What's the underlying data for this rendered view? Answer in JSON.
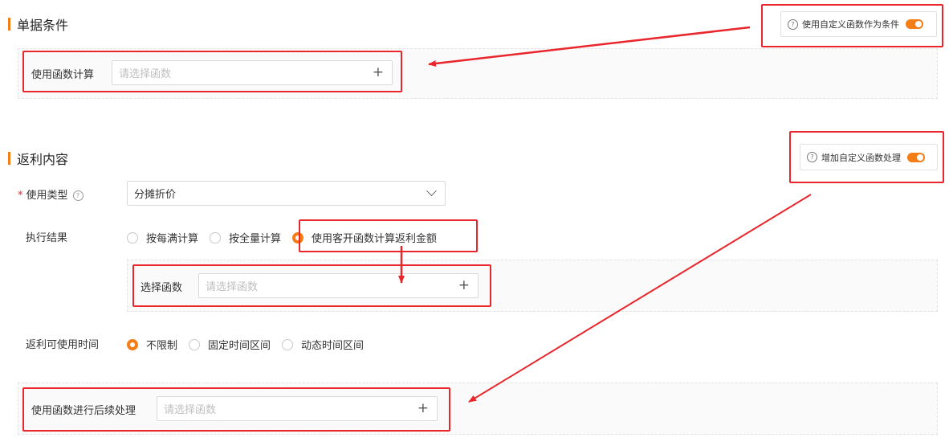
{
  "sections": {
    "bill_conditions": {
      "title": "单据条件",
      "toggle_label": "使用自定义函数作为条件",
      "calc_label": "使用函数计算",
      "calc_placeholder": "请选择函数"
    },
    "rebate_content": {
      "title": "返利内容",
      "toggle_label": "增加自定义函数处理",
      "use_type_label": "使用类型",
      "use_type_value": "分摊折价",
      "exec_result_label": "执行结果",
      "exec_options": [
        "按每满计算",
        "按全量计算",
        "使用客开函数计算返利金额"
      ],
      "exec_selected": 2,
      "select_func_label": "选择函数",
      "select_func_placeholder": "请选择函数",
      "time_label": "返利可使用时间",
      "time_options": [
        "不限制",
        "固定时间区间",
        "动态时间区间"
      ],
      "time_selected": 0,
      "post_label": "使用函数进行后续处理",
      "post_placeholder": "请选择函数"
    }
  },
  "colors": {
    "accent": "#f57d15",
    "annotation_red": "#e8262b"
  },
  "icons": {
    "add": "plus-icon",
    "help": "question-circle-icon",
    "dropdown": "chevron-down-icon"
  }
}
